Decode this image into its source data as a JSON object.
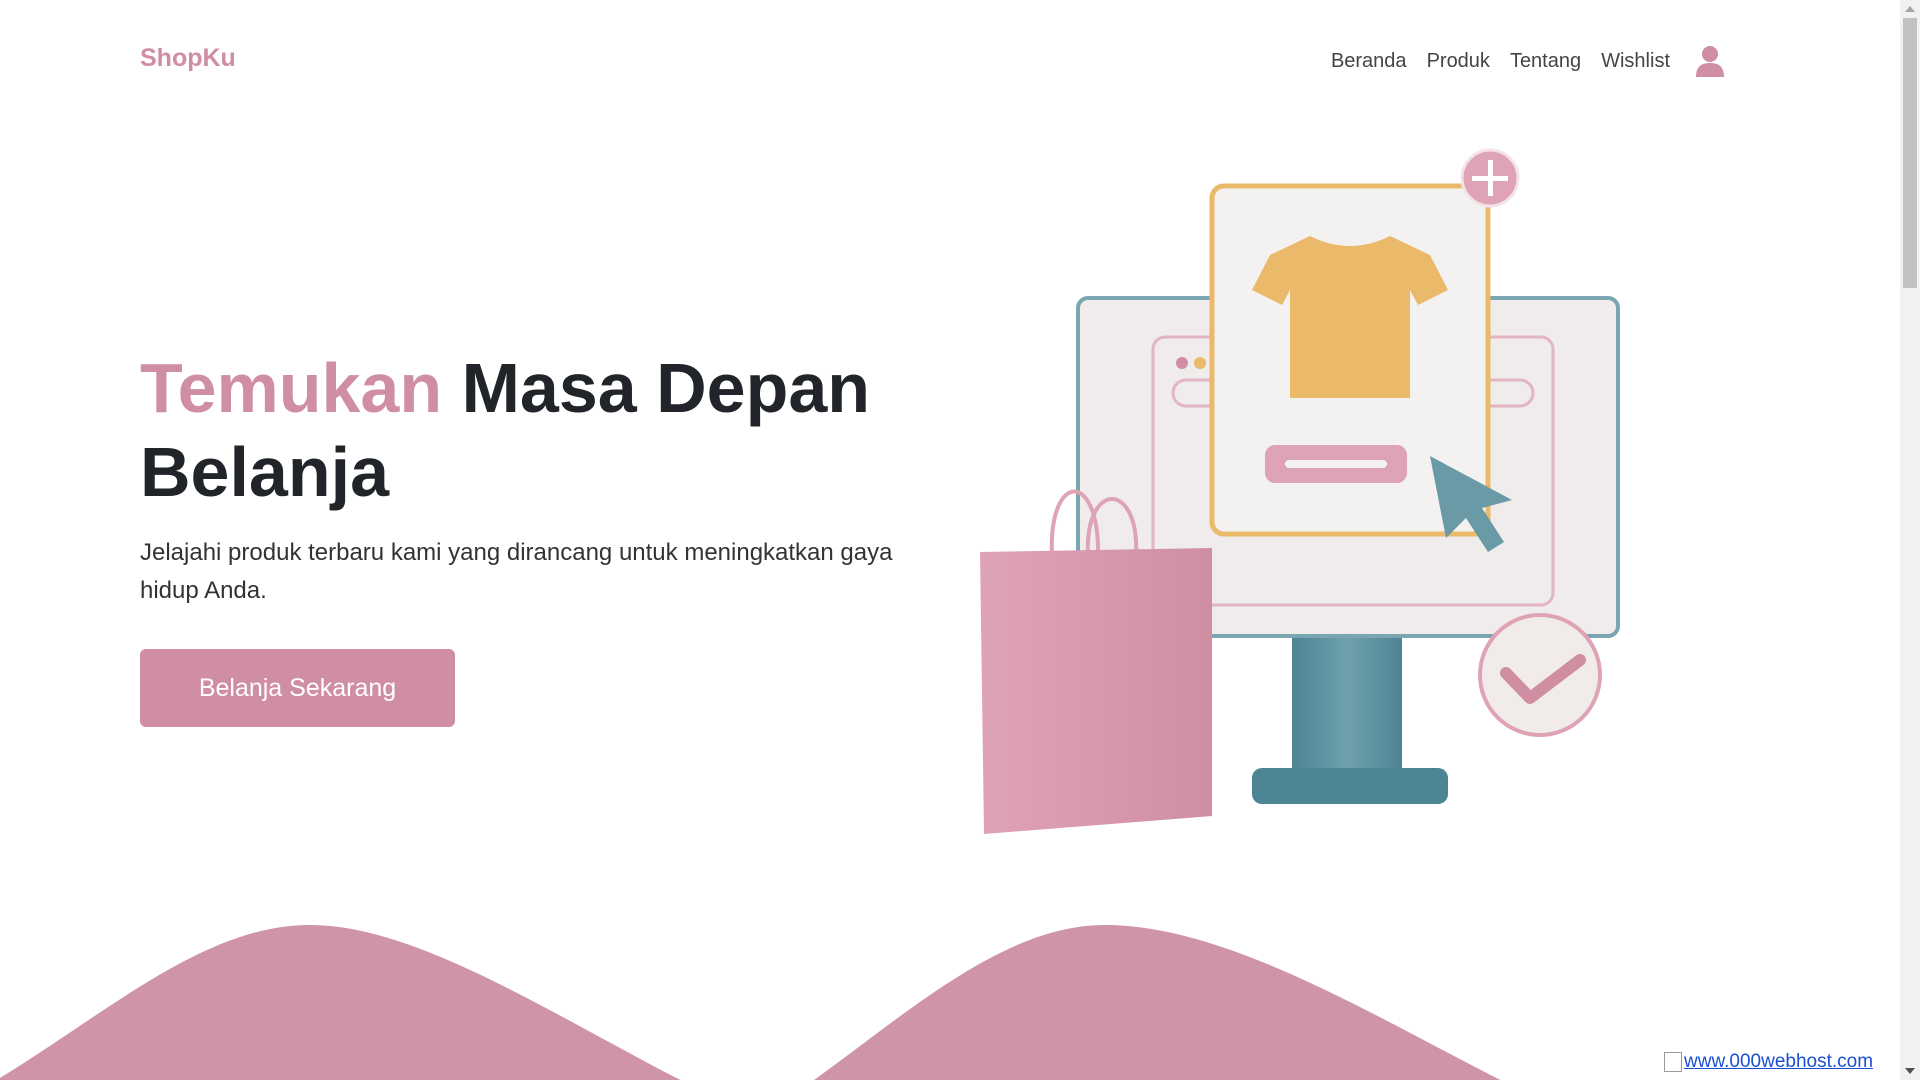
{
  "brand": {
    "name": "ShopKu",
    "color": "#cf8ea2"
  },
  "nav": {
    "links": [
      "Beranda",
      "Produk",
      "Tentang",
      "Wishlist"
    ],
    "user_icon": "user-icon"
  },
  "hero": {
    "title_accent": "Temukan",
    "title_rest": " Masa Depan Belanja",
    "subtitle": "Jelajahi produk terbaru kami yang dirancang untuk meningkatkan gaya hidup Anda.",
    "cta_label": "Belanja Sekarang"
  },
  "illustration": {
    "icons": [
      "monitor-icon",
      "tshirt-icon",
      "shopping-bag-icon",
      "cursor-icon",
      "plus-icon",
      "check-icon"
    ]
  },
  "footer_badge": {
    "link_text": "www.000webhost.com"
  },
  "colors": {
    "accent": "#cf8ea2",
    "teal": "#6a9aa6",
    "yellow": "#eab96a",
    "text_dark": "#212529"
  }
}
